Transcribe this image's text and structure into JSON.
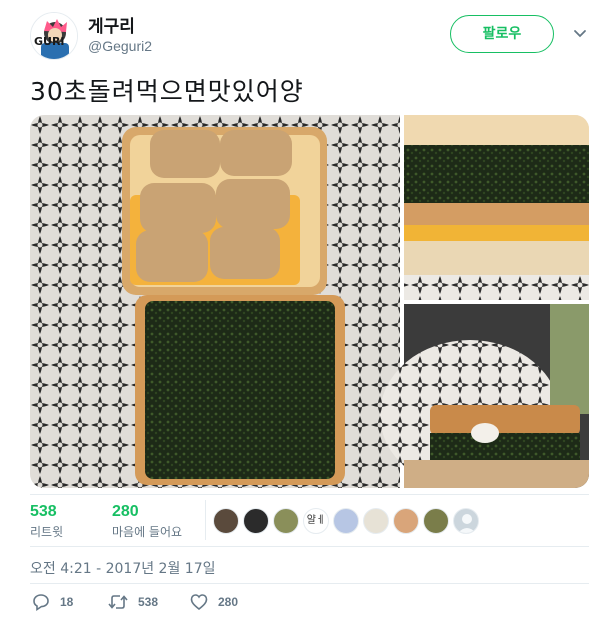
{
  "user": {
    "name": "게구리",
    "handle": "@Geguri2",
    "avatar_icon": "gamer-avatar-icon",
    "avatar_text": "GURI"
  },
  "follow_button": {
    "label": "팔로우"
  },
  "menu_icon": "chevron-down-icon",
  "tweet": {
    "text": "30초돌려먹으면맛있어양"
  },
  "media": {
    "images": [
      "open-sandwich-with-rice-cakes-and-seaweed",
      "sandwich-side-view",
      "bitten-sandwich-closeup"
    ]
  },
  "stats": {
    "retweets": {
      "count": "538",
      "label": "리트윗"
    },
    "likes": {
      "count": "280",
      "label": "마음에 들어요"
    }
  },
  "likers": [
    {
      "icon": "liker-avatar-1",
      "color": "#5a4a3c"
    },
    {
      "icon": "liker-avatar-2",
      "color": "#2b2b2b"
    },
    {
      "icon": "liker-avatar-3",
      "color": "#8a8f5a"
    },
    {
      "icon": "liker-avatar-4",
      "color": "#ffffff"
    },
    {
      "icon": "liker-avatar-5",
      "color": "#b7c6e4"
    },
    {
      "icon": "liker-avatar-6",
      "color": "#e7e2d6"
    },
    {
      "icon": "liker-avatar-7",
      "color": "#d9a57a"
    },
    {
      "icon": "liker-avatar-8",
      "color": "#7a7d4a"
    },
    {
      "icon": "default-egg-avatar",
      "color": "#ccd6dd"
    }
  ],
  "liker_handwriting": "얄ㅔ",
  "timestamp": "오전 4:21 - 2017년 2월 17일",
  "actions": {
    "reply": {
      "icon": "reply-icon",
      "count": "18"
    },
    "retweet": {
      "icon": "retweet-icon",
      "count": "538"
    },
    "like": {
      "icon": "heart-icon",
      "count": "280"
    }
  },
  "colors": {
    "accent": "#17bf63",
    "text": "#14171a",
    "muted": "#657786",
    "border": "#e6ecf0"
  }
}
